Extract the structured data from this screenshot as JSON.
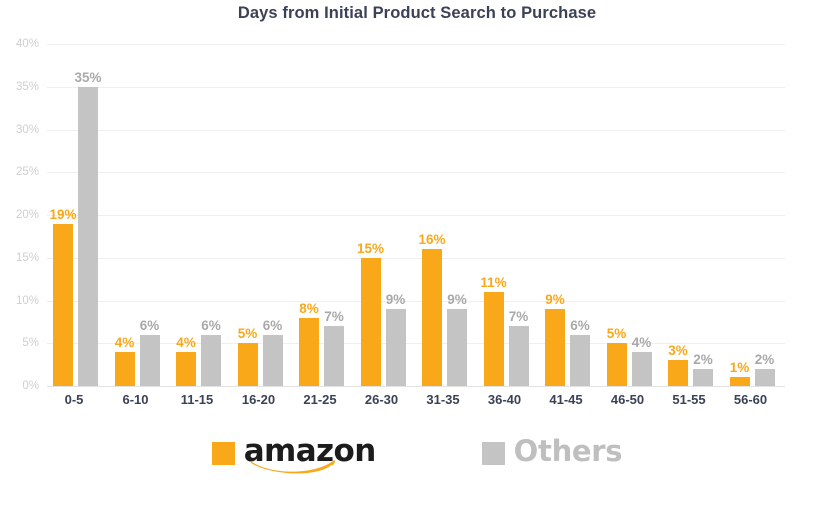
{
  "chart_data": {
    "type": "bar",
    "title": "Days from Initial Product Search to Purchase",
    "xlabel": "",
    "ylabel": "",
    "categories": [
      "0-5",
      "6-10",
      "11-15",
      "16-20",
      "21-25",
      "26-30",
      "31-35",
      "36-40",
      "41-45",
      "46-50",
      "51-55",
      "56-60"
    ],
    "series": [
      {
        "name": "amazon",
        "color": "#F9A81A",
        "values": [
          19,
          4,
          4,
          5,
          8,
          15,
          16,
          11,
          9,
          5,
          3,
          1
        ],
        "labels": [
          "19%",
          "4%",
          "4%",
          "5%",
          "8%",
          "15%",
          "16%",
          "11%",
          "9%",
          "5%",
          "3%",
          "1%"
        ]
      },
      {
        "name": "Others",
        "color": "#C4C4C4",
        "values": [
          35,
          6,
          6,
          6,
          7,
          9,
          9,
          7,
          6,
          4,
          2,
          2
        ],
        "labels": [
          "35%",
          "6%",
          "6%",
          "6%",
          "7%",
          "9%",
          "9%",
          "7%",
          "6%",
          "4%",
          "2%",
          "2%"
        ]
      }
    ],
    "ylim": [
      0,
      40
    ],
    "yticks": [
      0,
      5,
      10,
      15,
      20,
      25,
      30,
      35,
      40
    ],
    "ytick_labels": [
      "0%",
      "5%",
      "10%",
      "15%",
      "20%",
      "25%",
      "30%",
      "35%",
      "40%"
    ],
    "grid": true,
    "legend_position": "bottom"
  },
  "legend": {
    "items": [
      {
        "label": "amazon",
        "swatch_color": "#F9A81A",
        "icon": "amazon-smile-icon"
      },
      {
        "label": "Others",
        "swatch_color": "#C4C4C4"
      }
    ]
  },
  "colors": {
    "amazon_orange": "#F9A81A",
    "others_gray": "#C4C4C4",
    "title_navy": "#3b4256",
    "gridline": "#efefef",
    "ytick_text": "#cfcfcf",
    "background": "#ffffff"
  }
}
